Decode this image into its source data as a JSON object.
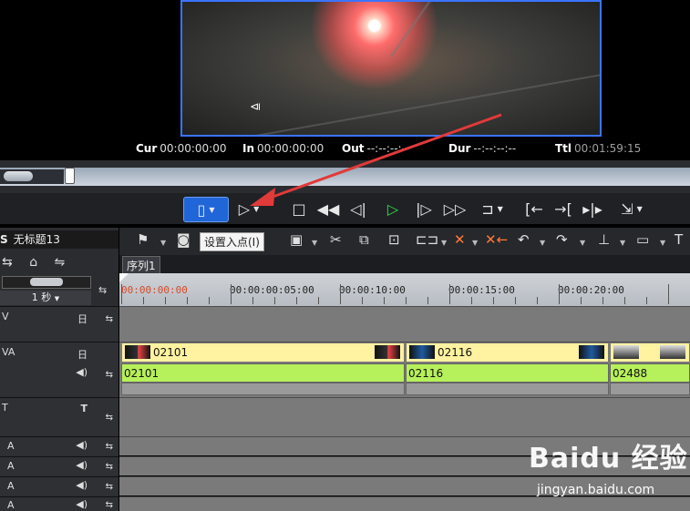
{
  "preview": {
    "timecodes": [
      {
        "label": "Cur",
        "value": "00:00:00:00"
      },
      {
        "label": "In",
        "value": "00:00:00:00"
      },
      {
        "label": "Out",
        "value": "--:--:--:--"
      },
      {
        "label": "Dur",
        "value": "--:--:--:--"
      },
      {
        "label": "Ttl",
        "value": "00:01:59:15"
      }
    ]
  },
  "transport": {
    "icons": [
      "set-in-icon",
      "set-out-icon",
      "stop-icon",
      "rewind-icon",
      "step-back-icon",
      "play-icon",
      "step-forward-icon",
      "fast-forward-icon",
      "loop-icon",
      "match-frame-icon",
      "insert-icon",
      "overwrite-icon",
      "export-icon"
    ]
  },
  "project": {
    "title_prefix": "S",
    "title": "无标题13"
  },
  "toolbar": {
    "tooltip": "设置入点(I)"
  },
  "sequence": {
    "tab": "序列1",
    "zoom": "1 秒"
  },
  "ruler": {
    "labels": [
      "00:00:00:00",
      "00:00:00:05:00",
      "00:00:10:00",
      "00:00:15:00",
      "00:00:20:00"
    ]
  },
  "tracks": {
    "v": "V",
    "va": "VA",
    "t": "T",
    "a_labels": [
      "A",
      "A",
      "A",
      "A"
    ],
    "clips_video": [
      "02101",
      "02116",
      ""
    ],
    "clips_audio": [
      "02101",
      "02116",
      "02488"
    ]
  },
  "watermark": {
    "main": "Baidu 经验",
    "sub": "jingyan.baidu.com"
  },
  "colors": {
    "accent": "#2166d8",
    "annotation": "#e03a3a",
    "play": "#2fe04d"
  }
}
